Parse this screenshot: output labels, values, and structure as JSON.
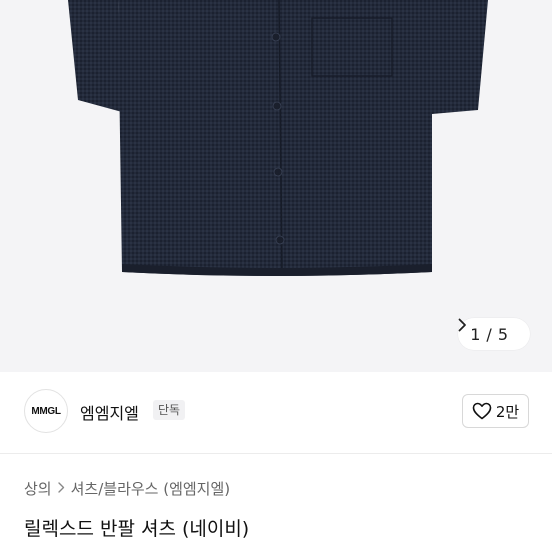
{
  "pager": {
    "current": "1",
    "separator": "/",
    "total": "5"
  },
  "shop": {
    "logo_text": "MMGL",
    "name": "엠엠지엘",
    "badge": "단독"
  },
  "like": {
    "count": "2만"
  },
  "breadcrumb": {
    "items": [
      "상의",
      "셔츠/블라우스 (엠엠지엘)"
    ]
  },
  "product": {
    "title": "릴렉스드 반팔 셔츠 (네이비)"
  },
  "colors": {
    "shirt": "#232a3a",
    "hero_bg": "#f4f4f6"
  },
  "icons": {
    "next": "chevron-right-icon",
    "like": "heart-outline-icon"
  }
}
